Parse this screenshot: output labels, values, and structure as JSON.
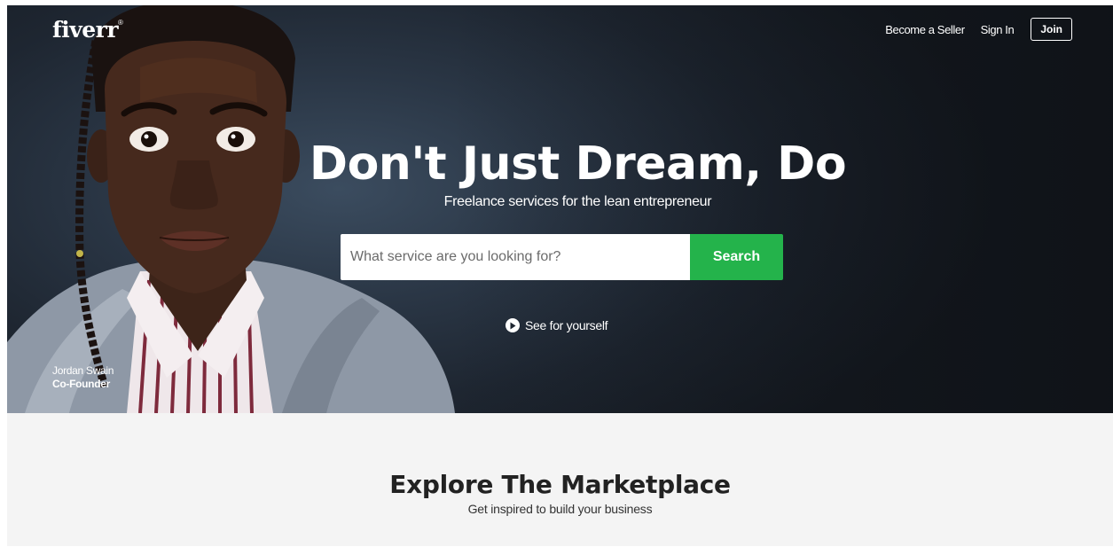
{
  "brand": {
    "logo_text": "fiverr",
    "trademark": "®"
  },
  "nav": {
    "become_seller": "Become a Seller",
    "sign_in": "Sign In",
    "join": "Join"
  },
  "hero": {
    "title": "Don't Just Dream, Do",
    "subtitle": "Freelance services for the lean entrepreneur",
    "see_link": "See for yourself",
    "icons": [
      "play-icon"
    ]
  },
  "search": {
    "placeholder": "What service are you looking for?",
    "value": "",
    "button_label": "Search"
  },
  "caption": {
    "name": "Jordan Swain",
    "role": "Co-Founder"
  },
  "marketplace": {
    "title": "Explore The Marketplace",
    "subtitle": "Get inspired to build your business"
  },
  "colors": {
    "accent_green": "#24b34b",
    "hero_background": "#1e2631",
    "section_background": "#f4f4f4"
  }
}
